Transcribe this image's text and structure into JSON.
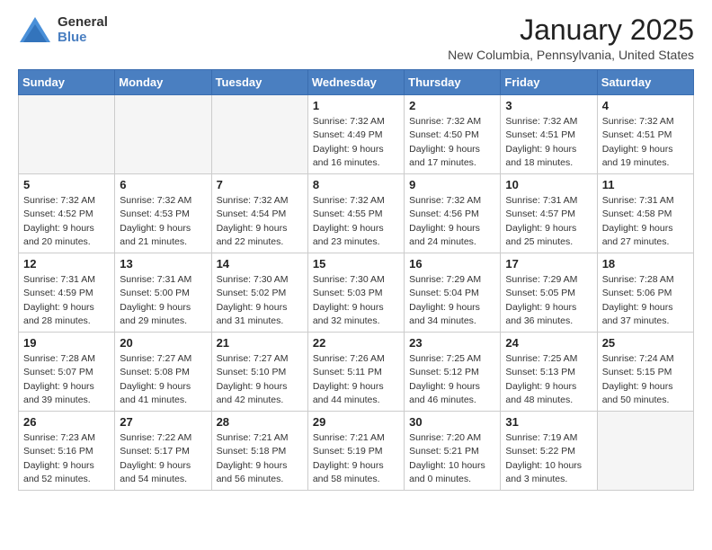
{
  "header": {
    "logo_line1": "General",
    "logo_line2": "Blue",
    "title": "January 2025",
    "subtitle": "New Columbia, Pennsylvania, United States"
  },
  "weekdays": [
    "Sunday",
    "Monday",
    "Tuesday",
    "Wednesday",
    "Thursday",
    "Friday",
    "Saturday"
  ],
  "weeks": [
    [
      {
        "day": "",
        "info": ""
      },
      {
        "day": "",
        "info": ""
      },
      {
        "day": "",
        "info": ""
      },
      {
        "day": "1",
        "info": "Sunrise: 7:32 AM\nSunset: 4:49 PM\nDaylight: 9 hours\nand 16 minutes."
      },
      {
        "day": "2",
        "info": "Sunrise: 7:32 AM\nSunset: 4:50 PM\nDaylight: 9 hours\nand 17 minutes."
      },
      {
        "day": "3",
        "info": "Sunrise: 7:32 AM\nSunset: 4:51 PM\nDaylight: 9 hours\nand 18 minutes."
      },
      {
        "day": "4",
        "info": "Sunrise: 7:32 AM\nSunset: 4:51 PM\nDaylight: 9 hours\nand 19 minutes."
      }
    ],
    [
      {
        "day": "5",
        "info": "Sunrise: 7:32 AM\nSunset: 4:52 PM\nDaylight: 9 hours\nand 20 minutes."
      },
      {
        "day": "6",
        "info": "Sunrise: 7:32 AM\nSunset: 4:53 PM\nDaylight: 9 hours\nand 21 minutes."
      },
      {
        "day": "7",
        "info": "Sunrise: 7:32 AM\nSunset: 4:54 PM\nDaylight: 9 hours\nand 22 minutes."
      },
      {
        "day": "8",
        "info": "Sunrise: 7:32 AM\nSunset: 4:55 PM\nDaylight: 9 hours\nand 23 minutes."
      },
      {
        "day": "9",
        "info": "Sunrise: 7:32 AM\nSunset: 4:56 PM\nDaylight: 9 hours\nand 24 minutes."
      },
      {
        "day": "10",
        "info": "Sunrise: 7:31 AM\nSunset: 4:57 PM\nDaylight: 9 hours\nand 25 minutes."
      },
      {
        "day": "11",
        "info": "Sunrise: 7:31 AM\nSunset: 4:58 PM\nDaylight: 9 hours\nand 27 minutes."
      }
    ],
    [
      {
        "day": "12",
        "info": "Sunrise: 7:31 AM\nSunset: 4:59 PM\nDaylight: 9 hours\nand 28 minutes."
      },
      {
        "day": "13",
        "info": "Sunrise: 7:31 AM\nSunset: 5:00 PM\nDaylight: 9 hours\nand 29 minutes."
      },
      {
        "day": "14",
        "info": "Sunrise: 7:30 AM\nSunset: 5:02 PM\nDaylight: 9 hours\nand 31 minutes."
      },
      {
        "day": "15",
        "info": "Sunrise: 7:30 AM\nSunset: 5:03 PM\nDaylight: 9 hours\nand 32 minutes."
      },
      {
        "day": "16",
        "info": "Sunrise: 7:29 AM\nSunset: 5:04 PM\nDaylight: 9 hours\nand 34 minutes."
      },
      {
        "day": "17",
        "info": "Sunrise: 7:29 AM\nSunset: 5:05 PM\nDaylight: 9 hours\nand 36 minutes."
      },
      {
        "day": "18",
        "info": "Sunrise: 7:28 AM\nSunset: 5:06 PM\nDaylight: 9 hours\nand 37 minutes."
      }
    ],
    [
      {
        "day": "19",
        "info": "Sunrise: 7:28 AM\nSunset: 5:07 PM\nDaylight: 9 hours\nand 39 minutes."
      },
      {
        "day": "20",
        "info": "Sunrise: 7:27 AM\nSunset: 5:08 PM\nDaylight: 9 hours\nand 41 minutes."
      },
      {
        "day": "21",
        "info": "Sunrise: 7:27 AM\nSunset: 5:10 PM\nDaylight: 9 hours\nand 42 minutes."
      },
      {
        "day": "22",
        "info": "Sunrise: 7:26 AM\nSunset: 5:11 PM\nDaylight: 9 hours\nand 44 minutes."
      },
      {
        "day": "23",
        "info": "Sunrise: 7:25 AM\nSunset: 5:12 PM\nDaylight: 9 hours\nand 46 minutes."
      },
      {
        "day": "24",
        "info": "Sunrise: 7:25 AM\nSunset: 5:13 PM\nDaylight: 9 hours\nand 48 minutes."
      },
      {
        "day": "25",
        "info": "Sunrise: 7:24 AM\nSunset: 5:15 PM\nDaylight: 9 hours\nand 50 minutes."
      }
    ],
    [
      {
        "day": "26",
        "info": "Sunrise: 7:23 AM\nSunset: 5:16 PM\nDaylight: 9 hours\nand 52 minutes."
      },
      {
        "day": "27",
        "info": "Sunrise: 7:22 AM\nSunset: 5:17 PM\nDaylight: 9 hours\nand 54 minutes."
      },
      {
        "day": "28",
        "info": "Sunrise: 7:21 AM\nSunset: 5:18 PM\nDaylight: 9 hours\nand 56 minutes."
      },
      {
        "day": "29",
        "info": "Sunrise: 7:21 AM\nSunset: 5:19 PM\nDaylight: 9 hours\nand 58 minutes."
      },
      {
        "day": "30",
        "info": "Sunrise: 7:20 AM\nSunset: 5:21 PM\nDaylight: 10 hours\nand 0 minutes."
      },
      {
        "day": "31",
        "info": "Sunrise: 7:19 AM\nSunset: 5:22 PM\nDaylight: 10 hours\nand 3 minutes."
      },
      {
        "day": "",
        "info": ""
      }
    ]
  ]
}
